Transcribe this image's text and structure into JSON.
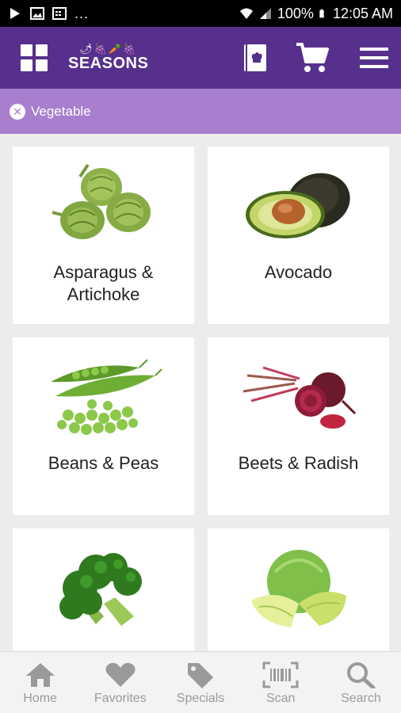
{
  "status_bar": {
    "overflow": "...",
    "battery": "100%",
    "time": "12:05 AM"
  },
  "app_bar": {
    "logo_text": "SEASONS",
    "logo_mark": "🌶🍇🥕🍇"
  },
  "filter": {
    "label": "Vegetable",
    "clear_glyph": "✕"
  },
  "items": [
    {
      "label_line1": "Asparagus &",
      "label_line2": "Artichoke"
    },
    {
      "label_line1": "Avocado",
      "label_line2": ""
    },
    {
      "label_line1": "Beans & Peas",
      "label_line2": ""
    },
    {
      "label_line1": "Beets & Radish",
      "label_line2": ""
    },
    {
      "label_line1": "",
      "label_line2": ""
    },
    {
      "label_line1": "",
      "label_line2": ""
    }
  ],
  "bottom_nav": [
    {
      "label": "Home",
      "icon": "home-icon"
    },
    {
      "label": "Favorites",
      "icon": "heart-icon"
    },
    {
      "label": "Specials",
      "icon": "tag-icon"
    },
    {
      "label": "Scan",
      "icon": "barcode-icon"
    },
    {
      "label": "Search",
      "icon": "search-icon"
    }
  ],
  "colors": {
    "app_bar": "#56308c",
    "filter_bar": "#a77fce",
    "nav_inactive": "#9a9a9a"
  }
}
